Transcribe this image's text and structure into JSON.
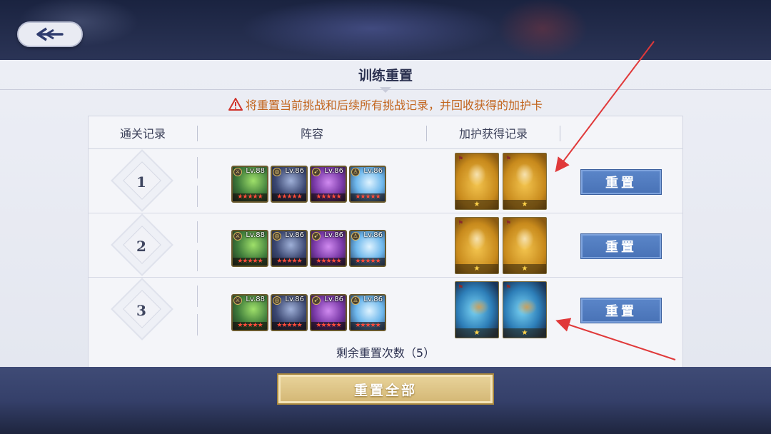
{
  "header": {
    "back_icon": "back-arrow-icon"
  },
  "panel": {
    "title": "训练重置",
    "warning": "将重置当前挑战和后续所有挑战记录，并回收获得的加护卡",
    "columns": [
      "通关记录",
      "阵容",
      "加护获得记录"
    ],
    "rows": [
      {
        "number": "1",
        "heroes": [
          {
            "level": "Lv.88",
            "stars": "★★★★★"
          },
          {
            "level": "Lv.86",
            "stars": "★★★★★"
          },
          {
            "level": "Lv.86",
            "stars": "★★★★★"
          },
          {
            "level": "Lv.86",
            "stars": "★★★★★"
          }
        ],
        "cards": [
          {
            "star": "★"
          },
          {
            "star": "★"
          }
        ],
        "reset_label": "重置"
      },
      {
        "number": "2",
        "heroes": [
          {
            "level": "Lv.88",
            "stars": "★★★★★"
          },
          {
            "level": "Lv.86",
            "stars": "★★★★★"
          },
          {
            "level": "Lv.86",
            "stars": "★★★★★"
          },
          {
            "level": "Lv.86",
            "stars": "★★★★★"
          }
        ],
        "cards": [
          {
            "star": "★"
          },
          {
            "star": "★"
          }
        ],
        "reset_label": "重置"
      },
      {
        "number": "3",
        "heroes": [
          {
            "level": "Lv.88",
            "stars": "★★★★★"
          },
          {
            "level": "Lv.86",
            "stars": "★★★★★"
          },
          {
            "level": "Lv.86",
            "stars": "★★★★★"
          },
          {
            "level": "Lv.86",
            "stars": "★★★★★"
          }
        ],
        "cards": [
          {
            "star": "★"
          },
          {
            "star": "★"
          }
        ],
        "reset_label": "重置"
      }
    ],
    "remaining": "剩余重置次数（5）"
  },
  "footer": {
    "reset_all_label": "重置全部"
  },
  "colors": {
    "warning": "#c2651e",
    "reset_button": "#4f7bc0",
    "reset_all_button": "#d9bd7c",
    "annotation_arrow": "#e0393a"
  }
}
